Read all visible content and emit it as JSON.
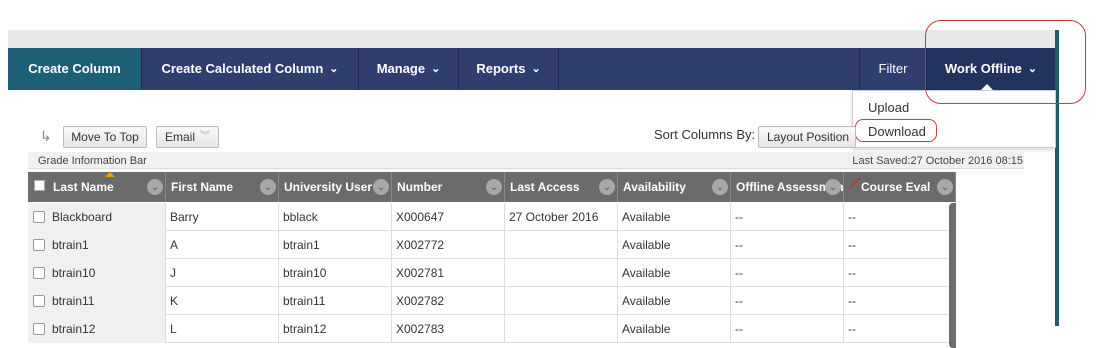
{
  "action_bar": {
    "create_column": "Create Column",
    "create_calculated_column": "Create Calculated Column",
    "manage": "Manage",
    "reports": "Reports",
    "filter": "Filter",
    "work_offline": "Work Offline",
    "chevron": "⌄"
  },
  "work_offline_menu": {
    "items": [
      "Upload",
      "Download"
    ]
  },
  "toolbar": {
    "arrow_glyph": "↳",
    "move_to_top": "Move To Top",
    "email": "Email",
    "sort_label": "Sort Columns By:",
    "sort_value": "Layout Position"
  },
  "info_bar": {
    "left": "Grade Information Bar",
    "right": "Last Saved:27 October 2016 08:15"
  },
  "grid": {
    "columns": [
      "Last Name",
      "First Name",
      "University User",
      "Number",
      "Last Access",
      "Availability",
      "Offline Assessment",
      "Course Eval"
    ],
    "rows": [
      {
        "last_name": "Blackboard",
        "first_name": "Barry",
        "user": "bblack",
        "number": "X000647",
        "last_access": "27 October 2016",
        "availability": "Available",
        "offline": "--",
        "course_eval": "--"
      },
      {
        "last_name": "btrain1",
        "first_name": "A",
        "user": "btrain1",
        "number": "X002772",
        "last_access": "",
        "availability": "Available",
        "offline": "--",
        "course_eval": "--"
      },
      {
        "last_name": "btrain10",
        "first_name": "J",
        "user": "btrain10",
        "number": "X002781",
        "last_access": "",
        "availability": "Available",
        "offline": "--",
        "course_eval": "--"
      },
      {
        "last_name": "btrain11",
        "first_name": "K",
        "user": "btrain11",
        "number": "X002782",
        "last_access": "",
        "availability": "Available",
        "offline": "--",
        "course_eval": "--"
      },
      {
        "last_name": "btrain12",
        "first_name": "L",
        "user": "btrain12",
        "number": "X002783",
        "last_access": "",
        "availability": "Available",
        "offline": "--",
        "course_eval": "--"
      }
    ]
  },
  "colors": {
    "action_bar": "#2f3e6e",
    "create_column_bg": "#1d5f74",
    "highlight_circle": "#c9393a",
    "grid_header": "#6b6b6b"
  }
}
